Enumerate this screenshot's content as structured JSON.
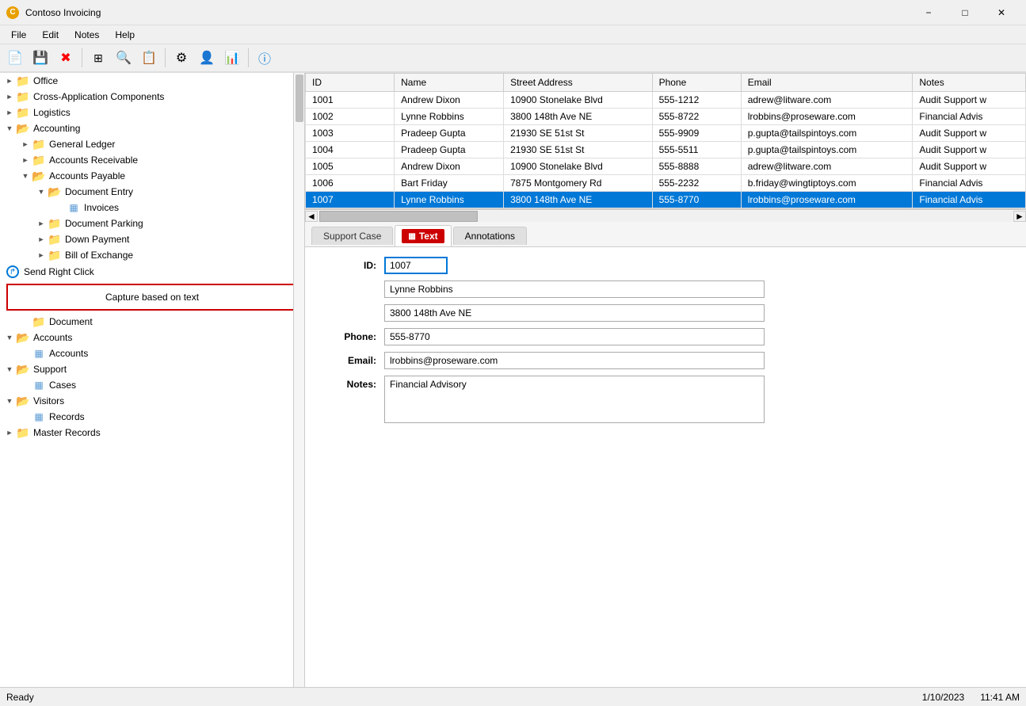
{
  "window": {
    "title": "Contoso Invoicing",
    "icon_label": "C"
  },
  "menu": {
    "items": [
      "File",
      "Edit",
      "Notes",
      "Help"
    ]
  },
  "toolbar": {
    "buttons": [
      {
        "name": "new-icon",
        "symbol": "📄"
      },
      {
        "name": "save-icon",
        "symbol": "💾"
      },
      {
        "name": "delete-icon",
        "symbol": "❌"
      },
      {
        "name": "grid-icon",
        "symbol": "▦"
      },
      {
        "name": "search-icon",
        "symbol": "🔍"
      },
      {
        "name": "note-icon",
        "symbol": "📋"
      },
      {
        "name": "settings-icon",
        "symbol": "⚙"
      },
      {
        "name": "person-icon",
        "symbol": "👤"
      },
      {
        "name": "export-icon",
        "symbol": "📊"
      },
      {
        "name": "info-icon",
        "symbol": "ℹ"
      }
    ]
  },
  "tree": {
    "items": [
      {
        "id": "office",
        "label": "Office",
        "level": 0,
        "expanded": false,
        "type": "folder"
      },
      {
        "id": "cross-app",
        "label": "Cross-Application Components",
        "level": 0,
        "expanded": false,
        "type": "folder"
      },
      {
        "id": "logistics",
        "label": "Logistics",
        "level": 0,
        "expanded": false,
        "type": "folder"
      },
      {
        "id": "accounting",
        "label": "Accounting",
        "level": 0,
        "expanded": true,
        "type": "folder"
      },
      {
        "id": "general-ledger",
        "label": "General Ledger",
        "level": 1,
        "expanded": false,
        "type": "folder"
      },
      {
        "id": "accounts-receivable",
        "label": "Accounts Receivable",
        "level": 1,
        "expanded": false,
        "type": "folder"
      },
      {
        "id": "accounts-payable",
        "label": "Accounts Payable",
        "level": 1,
        "expanded": true,
        "type": "folder"
      },
      {
        "id": "document-entry",
        "label": "Document Entry",
        "level": 2,
        "expanded": true,
        "type": "folder"
      },
      {
        "id": "invoices",
        "label": "Invoices",
        "level": 3,
        "expanded": false,
        "type": "table"
      },
      {
        "id": "document-parking",
        "label": "Document Parking",
        "level": 2,
        "expanded": false,
        "type": "folder"
      },
      {
        "id": "down-payment",
        "label": "Down Payment",
        "level": 2,
        "expanded": false,
        "type": "folder"
      },
      {
        "id": "bill-of-exchange",
        "label": "Bill of Exchange",
        "level": 2,
        "expanded": false,
        "type": "folder"
      },
      {
        "id": "send-right-click",
        "label": "Send Right Click",
        "level": 0,
        "type": "action"
      },
      {
        "id": "capture-text",
        "label": "Capture based on text",
        "level": 0,
        "type": "capture"
      },
      {
        "id": "document",
        "label": "Document",
        "level": 1,
        "type": "folder"
      },
      {
        "id": "accounts",
        "label": "Accounts",
        "level": 0,
        "expanded": true,
        "type": "folder"
      },
      {
        "id": "accounts-sub",
        "label": "Accounts",
        "level": 1,
        "type": "table"
      },
      {
        "id": "support",
        "label": "Support",
        "level": 0,
        "expanded": true,
        "type": "folder"
      },
      {
        "id": "cases",
        "label": "Cases",
        "level": 1,
        "type": "table"
      },
      {
        "id": "visitors",
        "label": "Visitors",
        "level": 0,
        "expanded": true,
        "type": "folder"
      },
      {
        "id": "records",
        "label": "Records",
        "level": 1,
        "type": "table"
      },
      {
        "id": "master-records",
        "label": "Master Records",
        "level": 0,
        "expanded": false,
        "type": "folder"
      }
    ]
  },
  "grid": {
    "columns": [
      "ID",
      "Name",
      "Street Address",
      "Phone",
      "Email",
      "Notes"
    ],
    "rows": [
      {
        "id": "1001",
        "name": "Andrew Dixon",
        "address": "10900 Stonelake Blvd",
        "phone": "555-1212",
        "email": "adrew@litware.com",
        "notes": "Audit Support w",
        "selected": false
      },
      {
        "id": "1002",
        "name": "Lynne Robbins",
        "address": "3800 148th Ave NE",
        "phone": "555-8722",
        "email": "lrobbins@proseware.com",
        "notes": "Financial Advis",
        "selected": false
      },
      {
        "id": "1003",
        "name": "Pradeep Gupta",
        "address": "21930 SE 51st St",
        "phone": "555-9909",
        "email": "p.gupta@tailspintoys.com",
        "notes": "Audit Support w",
        "selected": false
      },
      {
        "id": "1004",
        "name": "Pradeep Gupta",
        "address": "21930 SE 51st St",
        "phone": "555-5511",
        "email": "p.gupta@tailspintoys.com",
        "notes": "Audit Support w",
        "selected": false
      },
      {
        "id": "1005",
        "name": "Andrew Dixon",
        "address": "10900 Stonelake Blvd",
        "phone": "555-8888",
        "email": "adrew@litware.com",
        "notes": "Audit Support w",
        "selected": false
      },
      {
        "id": "1006",
        "name": "Bart Friday",
        "address": "7875 Montgomery Rd",
        "phone": "555-2232",
        "email": "b.friday@wingtiptoys.com",
        "notes": "Financial Advis",
        "selected": false
      },
      {
        "id": "1007",
        "name": "Lynne Robbins",
        "address": "3800 148th Ave NE",
        "phone": "555-8770",
        "email": "lrobbins@proseware.com",
        "notes": "Financial Advis",
        "selected": true
      }
    ]
  },
  "tabs": {
    "items": [
      {
        "id": "support-case",
        "label": "Support Case",
        "active": false
      },
      {
        "id": "text",
        "label": "Text",
        "active": true,
        "highlighted": true
      },
      {
        "id": "annotations",
        "label": "Annotations",
        "active": false
      }
    ]
  },
  "form": {
    "id_label": "ID:",
    "id_value": "1007",
    "name_value": "Lynne Robbins",
    "address_value": "3800 148th Ave NE",
    "phone_label": "Phone:",
    "phone_value": "555-8770",
    "email_label": "Email:",
    "email_value": "lrobbins@proseware.com",
    "notes_label": "Notes:",
    "notes_value": "Financial Advisory",
    "capture_text": "Capture based on text"
  },
  "status_bar": {
    "status": "Ready",
    "date": "1/10/2023",
    "time": "11:41 AM"
  }
}
